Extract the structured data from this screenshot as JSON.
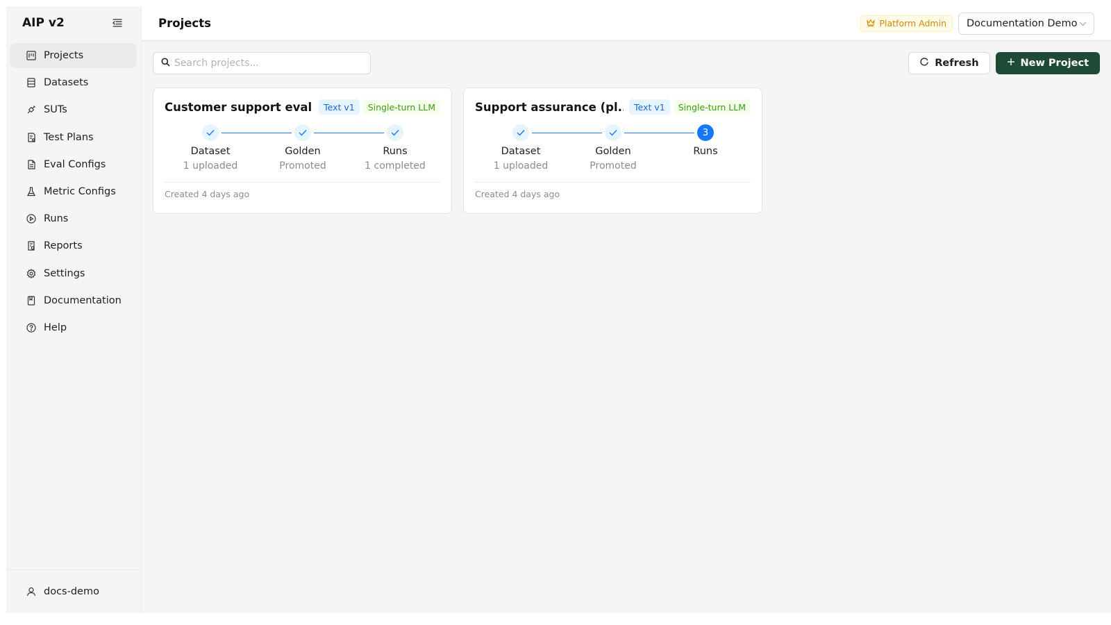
{
  "app": {
    "title": "AIP v2"
  },
  "sidebar": {
    "items": [
      {
        "label": "Projects",
        "icon": "projects-icon",
        "active": true
      },
      {
        "label": "Datasets",
        "icon": "datasets-icon"
      },
      {
        "label": "SUTs",
        "icon": "suts-icon"
      },
      {
        "label": "Test Plans",
        "icon": "test-plans-icon"
      },
      {
        "label": "Eval Configs",
        "icon": "eval-configs-icon"
      },
      {
        "label": "Metric Configs",
        "icon": "metric-configs-icon"
      },
      {
        "label": "Runs",
        "icon": "runs-icon"
      },
      {
        "label": "Reports",
        "icon": "reports-icon"
      },
      {
        "label": "Settings",
        "icon": "settings-icon"
      },
      {
        "label": "Documentation",
        "icon": "documentation-icon"
      },
      {
        "label": "Help",
        "icon": "help-icon"
      }
    ],
    "user": "docs-demo"
  },
  "header": {
    "title": "Projects",
    "admin_badge": "Platform Admin",
    "workspace": "Documentation Demo"
  },
  "toolbar": {
    "search_placeholder": "Search projects...",
    "refresh_label": "Refresh",
    "new_project_label": "New Project"
  },
  "colors": {
    "accent": "#1677ff",
    "primary_button": "#1f4a36",
    "admin_badge": "#d48806"
  },
  "projects": [
    {
      "title": "Customer support eval...",
      "tags": [
        "Text v1",
        "Single-turn LLM"
      ],
      "steps": [
        {
          "label": "Dataset",
          "desc": "1 uploaded",
          "status": "done"
        },
        {
          "label": "Golden",
          "desc": "Promoted",
          "status": "done"
        },
        {
          "label": "Runs",
          "desc": "1 completed",
          "status": "done"
        }
      ],
      "created": "Created 4 days ago"
    },
    {
      "title": "Support assurance (pl...",
      "tags": [
        "Text v1",
        "Single-turn LLM"
      ],
      "steps": [
        {
          "label": "Dataset",
          "desc": "1 uploaded",
          "status": "done"
        },
        {
          "label": "Golden",
          "desc": "Promoted",
          "status": "done"
        },
        {
          "label": "Runs",
          "desc": "",
          "status": "current",
          "number": "3"
        }
      ],
      "created": "Created 4 days ago"
    }
  ]
}
